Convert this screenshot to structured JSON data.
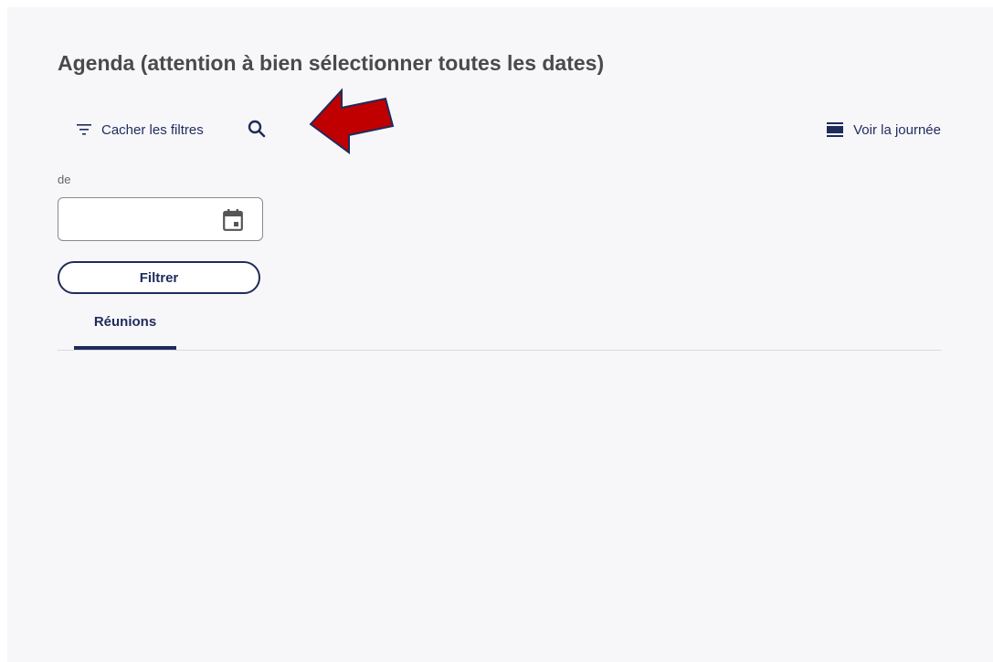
{
  "header": {
    "title": "Agenda (attention à bien sélectionner toutes les dates)"
  },
  "toolbar": {
    "filter_toggle_label": "Cacher les filtres",
    "filter_icon": "filter-list-icon",
    "search_icon": "search-icon",
    "day_view_label": "Voir la journée",
    "day_view_icon": "view-day-icon"
  },
  "annotation": {
    "arrow_color": "#c00000",
    "arrow_outline": "#1f2b5b"
  },
  "filters": {
    "date_from_label": "de",
    "date_from_value": "",
    "calendar_icon": "calendar-icon",
    "submit_label": "Filtrer"
  },
  "tabs": [
    {
      "label": "Réunions",
      "active": true
    }
  ],
  "colors": {
    "accent": "#1f2b5b",
    "background": "#f7f7fa",
    "title": "#4a4a4a"
  }
}
